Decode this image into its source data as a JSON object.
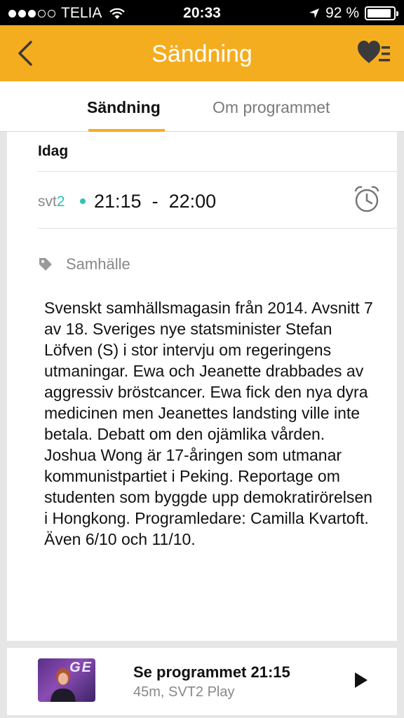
{
  "status_bar": {
    "carrier": "TELIA",
    "time": "20:33",
    "battery": "92 %",
    "battery_level": 0.92,
    "signal_bars": 3,
    "signal_max": 5
  },
  "nav": {
    "title": "Sändning",
    "back_icon": "chevron-left-icon",
    "favorite_icon": "heart-list-icon"
  },
  "tabs": [
    {
      "label": "Sändning",
      "active": true
    },
    {
      "label": "Om programmet",
      "active": false
    }
  ],
  "broadcast": {
    "day": "Idag",
    "channel_prefix": "svt",
    "channel_number": "2",
    "start": "21:15",
    "separator": "-",
    "end": "22:00",
    "reminder_icon": "alarm-clock-icon"
  },
  "category": {
    "label": "Samhälle",
    "icon": "tag-icon"
  },
  "description": "Svenskt samhällsmagasin från 2014. Avsnitt 7 av 18. Sveriges nye statsminister Stefan Löfven (S) i stor intervju om regeringens utmaningar. Ewa och Jeanette drabbades av aggressiv bröstcancer. Ewa fick den nya dyra medicinen men Jeanettes landsting ville inte betala. Debatt om den ojämlika vården. Joshua Wong är 17-åringen som utmanar kommunistpartiet i Peking. Reportage om studenten som byggde upp demokratirörelsen i Hongkong. Programledare: Camilla Kvartoft. Även 6/10 och 11/10.",
  "play": {
    "title": "Se programmet 21:15",
    "subtitle": "45m, SVT2 Play",
    "thumbnail_text": "GE",
    "play_icon": "play-icon"
  },
  "colors": {
    "accent": "#f5ad20",
    "svt2": "#30c3b3"
  }
}
